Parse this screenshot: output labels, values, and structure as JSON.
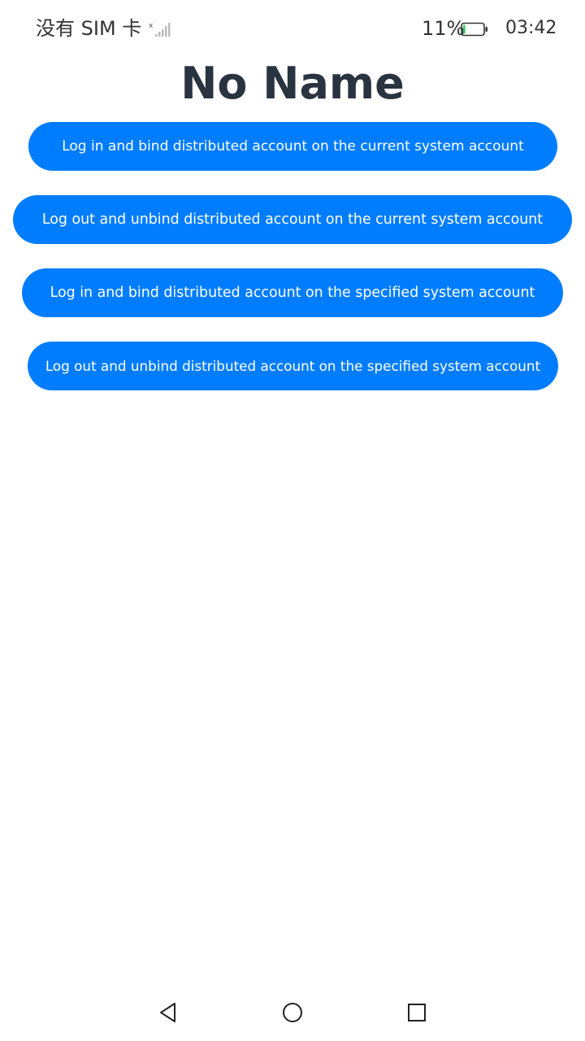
{
  "status_bar": {
    "carrier": "没有 SIM 卡",
    "battery_percent": "11%",
    "time": "03:42",
    "battery_level": 0.11,
    "signal_icon": "signal-none-icon",
    "battery_icon": "battery-low-icon"
  },
  "page": {
    "title": "No Name"
  },
  "buttons": [
    {
      "label": "Log in and bind distributed account on the current system account"
    },
    {
      "label": "Log out and unbind distributed account on the current system account"
    },
    {
      "label": "Log in and bind distributed account on the specified system account"
    },
    {
      "label": "Log out and unbind distributed account on the specified system account"
    }
  ],
  "nav_bar": {
    "back_icon": "back-triangle-icon",
    "home_icon": "home-circle-icon",
    "recent_icon": "recent-square-icon"
  },
  "colors": {
    "accent": "#007dff",
    "title": "#2a3340",
    "status_text": "#333333",
    "battery_fill": "#34c759"
  }
}
